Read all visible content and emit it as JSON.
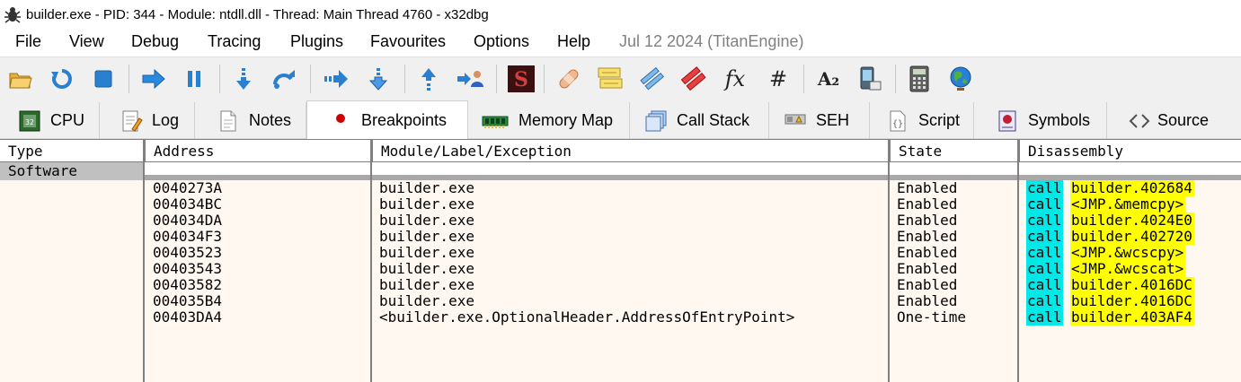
{
  "window": {
    "title": "builder.exe - PID: 344 - Module: ntdll.dll - Thread: Main Thread 4760 - x32dbg"
  },
  "menu": {
    "items": [
      "File",
      "View",
      "Debug",
      "Tracing",
      "Plugins",
      "Favourites",
      "Options",
      "Help"
    ],
    "info": "Jul 12 2024 (TitanEngine)"
  },
  "toolbar": {
    "buttons": [
      "open-icon",
      "restart-icon",
      "stop-icon",
      "run-icon",
      "pause-icon",
      "step-into-icon",
      "step-over-icon",
      "trace-into-icon",
      "trace-over-icon",
      "execute-till-return-icon",
      "run-to-user-code-icon",
      "scylla-icon",
      "patch-icon",
      "comments-icon",
      "labels-icon",
      "bookmarks-icon",
      "functions-icon",
      "variables-icon",
      "strings-icon",
      "device-icon",
      "calculator-icon",
      "globe-icon"
    ],
    "functions_label": "fx",
    "hash_label": "#",
    "strings_label": "A₂",
    "scylla_label": "S"
  },
  "tabs": [
    {
      "label": "CPU",
      "icon": "cpu-icon"
    },
    {
      "label": "Log",
      "icon": "log-icon"
    },
    {
      "label": "Notes",
      "icon": "notes-icon"
    },
    {
      "label": "Breakpoints",
      "icon": "breakpoint-icon",
      "active": true
    },
    {
      "label": "Memory Map",
      "icon": "memory-map-icon"
    },
    {
      "label": "Call Stack",
      "icon": "call-stack-icon"
    },
    {
      "label": "SEH",
      "icon": "seh-icon"
    },
    {
      "label": "Script",
      "icon": "script-icon"
    },
    {
      "label": "Symbols",
      "icon": "symbols-icon"
    },
    {
      "label": "Source",
      "icon": "source-icon"
    }
  ],
  "table": {
    "headers": [
      "Type",
      "Address",
      "Module/Label/Exception",
      "State",
      "Disassembly"
    ],
    "group": "Software",
    "rows": [
      {
        "address": "0040273A",
        "module": "builder.exe",
        "state": "Enabled",
        "mnemonic": "call",
        "target": "builder.402684"
      },
      {
        "address": "004034BC",
        "module": "builder.exe",
        "state": "Enabled",
        "mnemonic": "call",
        "target": "<JMP.&memcpy>"
      },
      {
        "address": "004034DA",
        "module": "builder.exe",
        "state": "Enabled",
        "mnemonic": "call",
        "target": "builder.4024E0"
      },
      {
        "address": "004034F3",
        "module": "builder.exe",
        "state": "Enabled",
        "mnemonic": "call",
        "target": "builder.402720"
      },
      {
        "address": "00403523",
        "module": "builder.exe",
        "state": "Enabled",
        "mnemonic": "call",
        "target": "<JMP.&wcscpy>"
      },
      {
        "address": "00403543",
        "module": "builder.exe",
        "state": "Enabled",
        "mnemonic": "call",
        "target": "<JMP.&wcscat>"
      },
      {
        "address": "00403582",
        "module": "builder.exe",
        "state": "Enabled",
        "mnemonic": "call",
        "target": "builder.4016DC"
      },
      {
        "address": "004035B4",
        "module": "builder.exe",
        "state": "Enabled",
        "mnemonic": "call",
        "target": "builder.4016DC"
      },
      {
        "address": "00403DA4",
        "module": "<builder.exe.OptionalHeader.AddressOfEntryPoint>",
        "state": "One-time",
        "mnemonic": "call",
        "target": "builder.403AF4"
      }
    ]
  },
  "colors": {
    "table_bg": "#fff8f0",
    "mnemonic_bg": "#00e8e8",
    "target_bg": "#ffff00",
    "breakpoint_dot": "#d00000"
  }
}
